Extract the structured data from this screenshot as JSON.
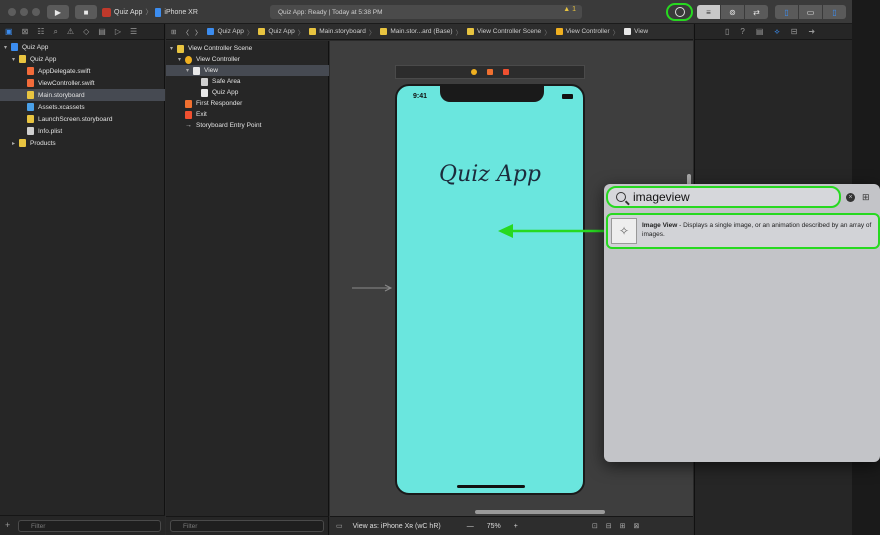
{
  "toolbar": {
    "scheme_target": "Quiz App",
    "device": "iPhone XR",
    "status_text": "Quiz App: Ready | Today at 5:38 PM",
    "warning_count": "1"
  },
  "navigator": {
    "items": [
      {
        "label": "Quiz App",
        "level": 0,
        "icon": "project-icon",
        "disclosure": "▾"
      },
      {
        "label": "Quiz App",
        "level": 1,
        "icon": "folder-icon",
        "disclosure": "▾"
      },
      {
        "label": "AppDelegate.swift",
        "level": 2,
        "icon": "swift-file-icon"
      },
      {
        "label": "ViewController.swift",
        "level": 2,
        "icon": "swift-file-icon"
      },
      {
        "label": "Main.storyboard",
        "level": 2,
        "icon": "storyboard-icon",
        "selected": true
      },
      {
        "label": "Assets.xcassets",
        "level": 2,
        "icon": "assets-icon"
      },
      {
        "label": "LaunchScreen.storyboard",
        "level": 2,
        "icon": "storyboard-icon"
      },
      {
        "label": "Info.plist",
        "level": 2,
        "icon": "plist-icon"
      },
      {
        "label": "Products",
        "level": 1,
        "icon": "folder-icon",
        "disclosure": "▸"
      }
    ],
    "filter_placeholder": "Filter"
  },
  "jumpbar": {
    "crumbs": [
      "Quiz App",
      "Quiz App",
      "Main.storyboard",
      "Main.stor...ard (Base)",
      "View Controller Scene",
      "View Controller",
      "View"
    ]
  },
  "outline": {
    "items": [
      {
        "label": "View Controller Scene",
        "level": 0,
        "disclosure": "▾"
      },
      {
        "label": "View Controller",
        "level": 1,
        "disclosure": "▾"
      },
      {
        "label": "View",
        "level": 2,
        "disclosure": "▾",
        "selected": true
      },
      {
        "label": "Safe Area",
        "level": 3
      },
      {
        "label": "Quiz App",
        "level": 3
      },
      {
        "label": "First Responder",
        "level": 1
      },
      {
        "label": "Exit",
        "level": 1
      },
      {
        "label": "Storyboard Entry Point",
        "level": 1
      }
    ],
    "filter_placeholder": "Filter"
  },
  "canvas": {
    "status_time": "9:41",
    "label_text": "Quiz App",
    "background_color": "#6ae6de"
  },
  "canvas_bar": {
    "view_as": "View as: iPhone Xʀ (wC hR)",
    "zoom": "75%",
    "minus": "—",
    "plus": "+"
  },
  "library": {
    "search_value": "imageview",
    "result_title": "Image View",
    "result_description": " - Displays a single image, or an animation described by an array of images."
  },
  "colors": {
    "highlight_green": "#27d920",
    "accent_blue": "#3c8df0"
  }
}
